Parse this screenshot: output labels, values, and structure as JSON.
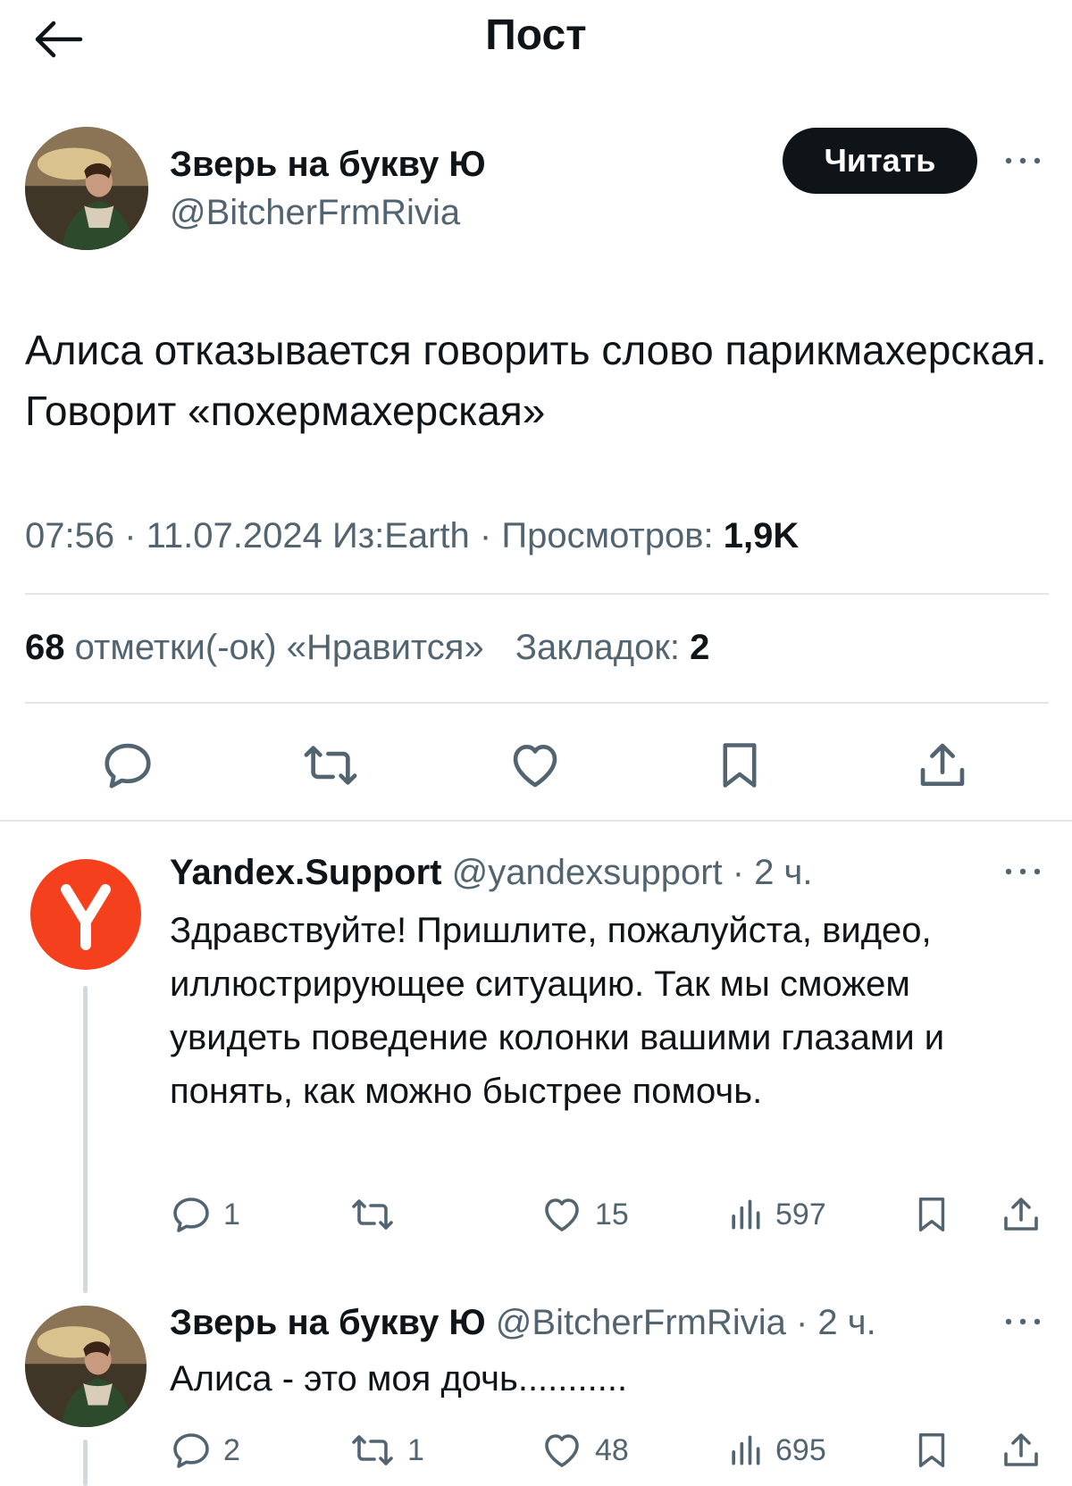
{
  "header": {
    "title": "Пост"
  },
  "post": {
    "author": {
      "name": "Зверь на букву Ю",
      "handle": "@BitcherFrmRivia"
    },
    "follow_label": "Читать",
    "text": "Алиса отказывается говорить слово парикмахерская. Говорит «похермахерская»",
    "meta": {
      "time_date_source": "07:56 · 11.07.2024 Из:Earth · Просмотров:",
      "views": "1,9K"
    },
    "stats": {
      "likes_count": "68",
      "likes_label": "отметки(-ок) «Нравится»",
      "bookmarks_label": "Закладок:",
      "bookmarks_count": "2"
    }
  },
  "replies": [
    {
      "author": {
        "name": "Yandex.Support",
        "handle": "@yandexsupport",
        "time": "· 2 ч."
      },
      "text": "Здравствуйте! Пришлите, пожалуйста, видео, иллюстрирующее ситуацию. Так мы сможем увидеть поведение колонки вашими глазами и понять, как можно быстрее помочь.",
      "counts": {
        "replies": "1",
        "retweets": "",
        "likes": "15",
        "views": "597"
      },
      "avatar_color": "#f4401c"
    },
    {
      "author": {
        "name": "Зверь на букву Ю",
        "handle": "@BitcherFrmRivia",
        "time": "· 2 ч."
      },
      "text": "Алиса - это моя дочь...........",
      "counts": {
        "replies": "2",
        "retweets": "1",
        "likes": "48",
        "views": "695"
      }
    }
  ],
  "icons": [
    "back-arrow-icon",
    "more-icon",
    "reply-icon",
    "retweet-icon",
    "like-icon",
    "bookmark-icon",
    "share-icon",
    "views-icon"
  ]
}
